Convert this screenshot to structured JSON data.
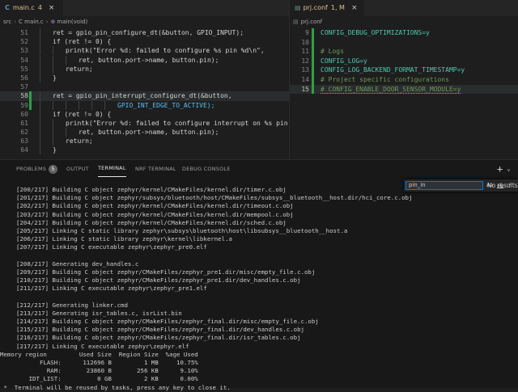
{
  "left_tab": {
    "icon": "C",
    "name": "main.c",
    "modified": "4",
    "close": "×"
  },
  "breadcrumb": {
    "part1": "src",
    "part2": "C main.c",
    "part3": "main(void)"
  },
  "left_code": [
    {
      "n": "51",
      "t": "ret = gpio_pin_configure_dt(&button, GPIO_INPUT);"
    },
    {
      "n": "52",
      "t": "if (ret != 0) {"
    },
    {
      "n": "53",
      "t": "printk(\"Error %d: failed to configure %s pin %d\\n\","
    },
    {
      "n": "54",
      "t": "ret, button.port->name, button.pin);"
    },
    {
      "n": "55",
      "t": "return;"
    },
    {
      "n": "56",
      "t": "}"
    },
    {
      "n": "57",
      "t": ""
    },
    {
      "n": "58",
      "t": "ret = gpio_pin_interrupt_configure_dt(&button,"
    },
    {
      "n": "59",
      "t": "GPIO_INT_EDGE_TO_ACTIVE);"
    },
    {
      "n": "60",
      "t": "if (ret != 0) {"
    },
    {
      "n": "61",
      "t": "printk(\"Error %d: failed to configure interrupt on %s pin %"
    },
    {
      "n": "62",
      "t": "ret, button.port->name, button.pin);"
    },
    {
      "n": "63",
      "t": "return;"
    },
    {
      "n": "64",
      "t": "}"
    }
  ],
  "right_tab": {
    "name": "prj.conf",
    "modified": "1, M",
    "close": "×"
  },
  "right_breadcrumb": "prj.conf",
  "right_code": [
    {
      "n": "9",
      "t": "CONFIG_DEBUG_OPTIMIZATIONS=y"
    },
    {
      "n": "10",
      "t": ""
    },
    {
      "n": "11",
      "t": "# Logs"
    },
    {
      "n": "12",
      "t": "CONFIG_LOG=y"
    },
    {
      "n": "13",
      "t": "CONFIG_LOG_BACKEND_FORMAT_TIMESTAMP=y"
    },
    {
      "n": "14",
      "t": "# Project specific configurations"
    },
    {
      "n": "15",
      "t": "# CONFIG_ENABLE_DOOR_SENSOR_MODULE=y"
    }
  ],
  "panel_tabs": {
    "problems": "PROBLEMS",
    "problems_count": "5",
    "output": "OUTPUT",
    "terminal": "TERMINAL",
    "nrf_terminal": "NRF TERMINAL",
    "debug_console": "DEBUG CONSOLE",
    "add": "+",
    "dropdown": "⌄"
  },
  "find": {
    "value": "pin_in",
    "case_label": "Aa",
    "word_label": "ab",
    "regex_label": ".*",
    "result": "No results"
  },
  "terminal_lines": [
    "[200/217] Building C object zephyr/kernel/CMakeFiles/kernel.dir/timer.c.obj",
    "[201/217] Building C object zephyr/subsys/bluetooth/host/CMakeFiles/subsys__bluetooth__host.dir/hci_core.c.obj",
    "[202/217] Building C object zephyr/kernel/CMakeFiles/kernel.dir/timeout.c.obj",
    "[203/217] Building C object zephyr/kernel/CMakeFiles/kernel.dir/mempool.c.obj",
    "[204/217] Building C object zephyr/kernel/CMakeFiles/kernel.dir/sched.c.obj",
    "[205/217] Linking C static library zephyr\\subsys\\bluetooth\\host\\libsubsys__bluetooth__host.a",
    "[206/217] Linking C static library zephyr\\kernel\\libkernel.a",
    "[207/217] Linking C executable zephyr\\zephyr_pre0.elf",
    "",
    "[208/217] Generating dev_handles.c",
    "[209/217] Building C object zephyr/CMakeFiles/zephyr_pre1.dir/misc/empty_file.c.obj",
    "[210/217] Building C object zephyr/CMakeFiles/zephyr_pre1.dir/dev_handles.c.obj",
    "[211/217] Linking C executable zephyr\\zephyr_pre1.elf",
    "",
    "[212/217] Generating linker.cmd",
    "[213/217] Generating isr_tables.c, isrList.bin",
    "[214/217] Building C object zephyr/CMakeFiles/zephyr_final.dir/misc/empty_file.c.obj",
    "[215/217] Building C object zephyr/CMakeFiles/zephyr_final.dir/dev_handles.c.obj",
    "[216/217] Building C object zephyr/CMakeFiles/zephyr_final.dir/isr_tables.c.obj",
    "[217/217] Linking C executable zephyr\\zephyr.elf",
    "Memory region         Used Size  Region Size  %age Used",
    "           FLASH:      112696 B         1 MB     10.75%",
    "             RAM:       23860 B       256 KB      9.10%",
    "        IDT_LIST:          0 GB         2 KB      0.00%",
    " *  Terminal will be reused by tasks, press any key to close it."
  ],
  "colors": {
    "accent": "#0078d4",
    "git_added": "#2ea043",
    "modified_tab": "#e2c08d"
  }
}
